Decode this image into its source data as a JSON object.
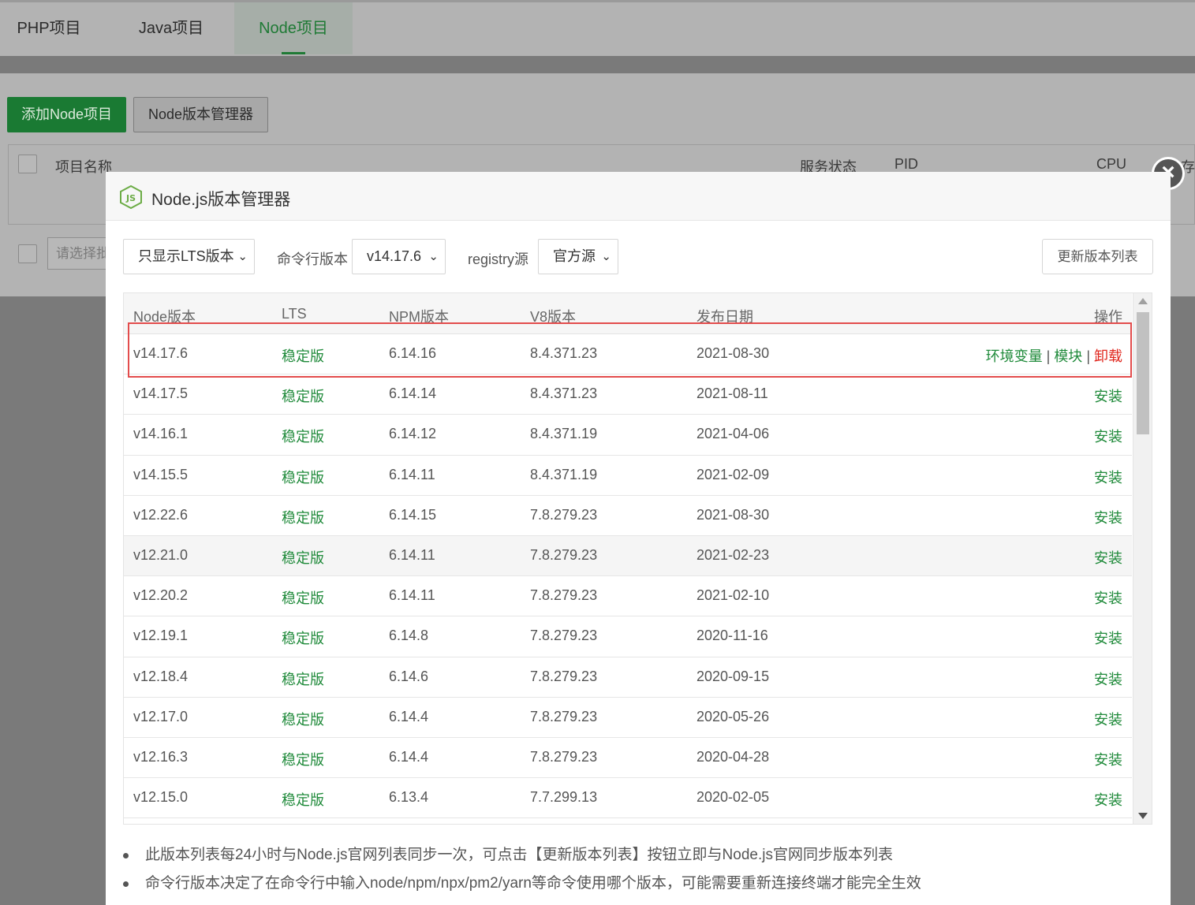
{
  "tabs": [
    {
      "label": "PHP项目"
    },
    {
      "label": "Java项目"
    },
    {
      "label": "Node项目"
    }
  ],
  "toolbar": {
    "add_label": "添加Node项目",
    "manager_label": "Node版本管理器"
  },
  "bg_table": {
    "headers": {
      "name": "项目名称",
      "status": "服务状态",
      "pid": "PID",
      "cpu": "CPU",
      "mem": "内存"
    },
    "batch_placeholder": "请选择批"
  },
  "modal": {
    "title": "Node.js版本管理器",
    "filter": {
      "value": "只显示LTS版本"
    },
    "cli_label": "命令行版本",
    "cli_value": "v14.17.6",
    "registry_label": "registry源",
    "registry_value": "官方源",
    "refresh_label": "更新版本列表",
    "columns": {
      "node": "Node版本",
      "lts": "LTS",
      "npm": "NPM版本",
      "v8": "V8版本",
      "date": "发布日期",
      "ops": "操作"
    },
    "rows": [
      {
        "node": "v14.17.6",
        "lts": "稳定版",
        "npm": "6.14.16",
        "v8": "8.4.371.23",
        "date": "2021-08-30",
        "installed": true
      },
      {
        "node": "v14.17.5",
        "lts": "稳定版",
        "npm": "6.14.14",
        "v8": "8.4.371.23",
        "date": "2021-08-11",
        "installed": false
      },
      {
        "node": "v14.16.1",
        "lts": "稳定版",
        "npm": "6.14.12",
        "v8": "8.4.371.19",
        "date": "2021-04-06",
        "installed": false
      },
      {
        "node": "v14.15.5",
        "lts": "稳定版",
        "npm": "6.14.11",
        "v8": "8.4.371.19",
        "date": "2021-02-09",
        "installed": false
      },
      {
        "node": "v12.22.6",
        "lts": "稳定版",
        "npm": "6.14.15",
        "v8": "7.8.279.23",
        "date": "2021-08-30",
        "installed": false
      },
      {
        "node": "v12.21.0",
        "lts": "稳定版",
        "npm": "6.14.11",
        "v8": "7.8.279.23",
        "date": "2021-02-23",
        "installed": false,
        "hover": true
      },
      {
        "node": "v12.20.2",
        "lts": "稳定版",
        "npm": "6.14.11",
        "v8": "7.8.279.23",
        "date": "2021-02-10",
        "installed": false
      },
      {
        "node": "v12.19.1",
        "lts": "稳定版",
        "npm": "6.14.8",
        "v8": "7.8.279.23",
        "date": "2020-11-16",
        "installed": false
      },
      {
        "node": "v12.18.4",
        "lts": "稳定版",
        "npm": "6.14.6",
        "v8": "7.8.279.23",
        "date": "2020-09-15",
        "installed": false
      },
      {
        "node": "v12.17.0",
        "lts": "稳定版",
        "npm": "6.14.4",
        "v8": "7.8.279.23",
        "date": "2020-05-26",
        "installed": false
      },
      {
        "node": "v12.16.3",
        "lts": "稳定版",
        "npm": "6.14.4",
        "v8": "7.8.279.23",
        "date": "2020-04-28",
        "installed": false
      },
      {
        "node": "v12.15.0",
        "lts": "稳定版",
        "npm": "6.13.4",
        "v8": "7.7.299.13",
        "date": "2020-02-05",
        "installed": false
      }
    ],
    "actions": {
      "env": "环境变量",
      "modules": "模块",
      "uninstall": "卸载",
      "install": "安装",
      "separator": "|"
    },
    "notes": [
      "此版本列表每24小时与Node.js官网列表同步一次，可点击【更新版本列表】按钮立即与Node.js官网同步版本列表",
      "命令行版本决定了在命令行中输入node/npm/npx/pm2/yarn等命令使用哪个版本，可能需要重新连接终端才能完全生效"
    ],
    "logo_text": "JS"
  },
  "colors": {
    "accent": "#1f8a3a",
    "danger": "#e0261d",
    "highlight": "#e34c4c"
  },
  "icons": {
    "close": "close-icon",
    "logo": "nodejs-logo-icon",
    "chevron": "chevron-down-icon"
  }
}
